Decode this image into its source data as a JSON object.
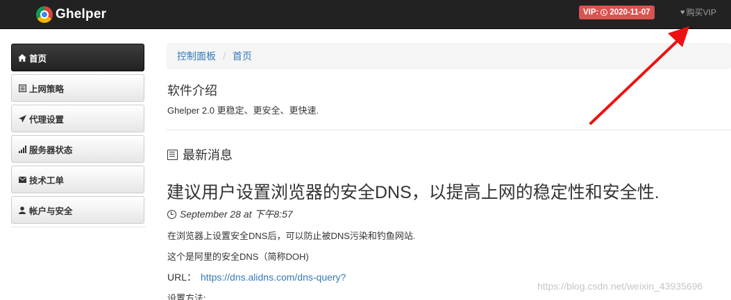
{
  "navbar": {
    "brand": "Ghelper",
    "vip_badge": "VIP: 2020-11-07",
    "buy_vip": "购买VIP"
  },
  "sidebar": {
    "items": [
      {
        "label": "首页",
        "icon": "home-icon",
        "active": true
      },
      {
        "label": "上网策略",
        "icon": "list-icon",
        "active": false
      },
      {
        "label": "代理设置",
        "icon": "send-icon",
        "active": false
      },
      {
        "label": "服务器状态",
        "icon": "signal-icon",
        "active": false
      },
      {
        "label": "技术工单",
        "icon": "envelope-icon",
        "active": false
      },
      {
        "label": "帐户与安全",
        "icon": "user-icon",
        "active": false
      }
    ]
  },
  "breadcrumb": {
    "items": [
      "控制面板",
      "首页"
    ]
  },
  "intro": {
    "title": "软件介绍",
    "text": "Ghelper 2.0 更稳定、更安全、更快速."
  },
  "news": {
    "heading": "最新消息",
    "post": {
      "title": "建议用户设置浏览器的安全DNS，以提高上网的稳定性和安全性.",
      "date": "September 28 at 下午8:57",
      "p1": "在浏览器上设置安全DNS后，可以防止被DNS污染和钓鱼网站.",
      "p2": "这个是阿里的安全DNS（简称DOH)",
      "url_label": "URL：",
      "url": "https://dns.alidns.com/dns-query?",
      "p3": "设置方法:"
    }
  },
  "watermark": "https://blog.csdn.net/weixin_43935696",
  "colors": {
    "navbar_bg": "#222222",
    "vip_badge": "#d9534f",
    "link": "#337ab7",
    "annotation_arrow": "#ee1111"
  }
}
